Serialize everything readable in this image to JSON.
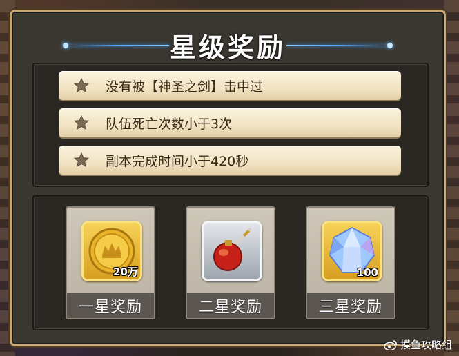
{
  "dialog": {
    "title": "星级奖励"
  },
  "conditions": [
    {
      "text": "没有被【神圣之剑】击中过",
      "icon": "star-icon"
    },
    {
      "text": "队伍死亡次数小于3次",
      "icon": "star-icon"
    },
    {
      "text": "副本完成时间小于420秒",
      "icon": "star-icon"
    }
  ],
  "rewards": [
    {
      "label": "一星奖励",
      "icon": "gold-coin-icon",
      "quantity": "20万"
    },
    {
      "label": "二星奖励",
      "icon": "potion-flask-icon",
      "quantity": ""
    },
    {
      "label": "三星奖励",
      "icon": "diamond-gem-icon",
      "quantity": "100"
    }
  ],
  "watermark": {
    "text": "摸鱼攻略组",
    "icon": "weibo-icon"
  },
  "colors": {
    "border_gold": "#c9a872",
    "condition_bg": "#f1e3c2",
    "title_line": "#4da6ff"
  }
}
